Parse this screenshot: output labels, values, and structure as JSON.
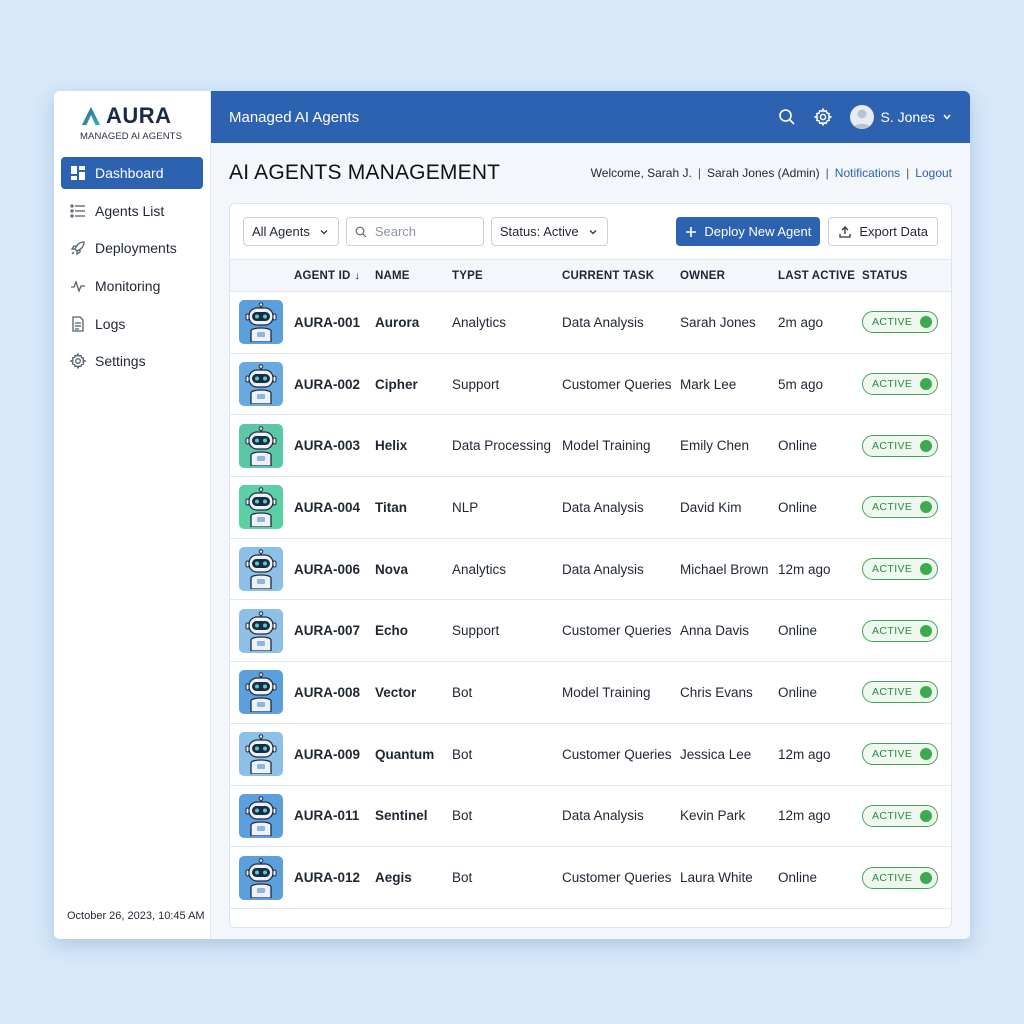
{
  "app": {
    "logo_text": "AURA",
    "logo_subtitle": "MANAGED AI AGENTS",
    "timestamp": "October 26, 2023, 10:45 AM"
  },
  "sidebar": {
    "items": [
      {
        "label": "Dashboard",
        "icon": "dashboard-icon",
        "active": true
      },
      {
        "label": "Agents List",
        "icon": "list-icon",
        "active": false
      },
      {
        "label": "Deployments",
        "icon": "rocket-icon",
        "active": false
      },
      {
        "label": "Monitoring",
        "icon": "pulse-icon",
        "active": false
      },
      {
        "label": "Logs",
        "icon": "document-icon",
        "active": false
      },
      {
        "label": "Settings",
        "icon": "gear-icon",
        "active": false
      }
    ]
  },
  "topbar": {
    "title": "Managed AI Agents",
    "user_name": "S. Jones"
  },
  "header": {
    "page_title": "AI AGENTS MANAGEMENT",
    "welcome": "Welcome, Sarah J.",
    "sep": "|",
    "role": "Sarah Jones (Admin)",
    "notifications": "Notifications",
    "logout": "Logout"
  },
  "toolbar": {
    "filter_label": "All Agents",
    "search_placeholder": "Search",
    "status_filter": "Status: Active",
    "deploy_label": "Deploy New Agent",
    "export_label": "Export Data"
  },
  "table": {
    "columns": [
      "AGENT ID",
      "NAME",
      "TYPE",
      "CURRENT TASK",
      "OWNER",
      "LAST ACTIVE",
      "STATUS"
    ],
    "sort_indicator": "↓",
    "rows": [
      {
        "id": "AURA-001",
        "name": "Aurora",
        "type": "Analytics",
        "task": "Data Analysis",
        "owner": "Sarah Jones",
        "last_active": "2m ago",
        "status": "ACTIVE",
        "avatar_bg": "#5b9fdc"
      },
      {
        "id": "AURA-002",
        "name": "Cipher",
        "type": "Support",
        "task": "Customer Queries",
        "owner": "Mark Lee",
        "last_active": "5m ago",
        "status": "ACTIVE",
        "avatar_bg": "#6aa9e0"
      },
      {
        "id": "AURA-003",
        "name": "Helix",
        "type": "Data Processing",
        "task": "Model Training",
        "owner": "Emily Chen",
        "last_active": "Online",
        "status": "ACTIVE",
        "avatar_bg": "#5cc7a7"
      },
      {
        "id": "AURA-004",
        "name": "Titan",
        "type": "NLP",
        "task": "Data Analysis",
        "owner": "David Kim",
        "last_active": "Online",
        "status": "ACTIVE",
        "avatar_bg": "#5ccfa4"
      },
      {
        "id": "AURA-006",
        "name": "Nova",
        "type": "Analytics",
        "task": "Data Analysis",
        "owner": "Michael Brown",
        "last_active": "12m ago",
        "status": "ACTIVE",
        "avatar_bg": "#8cc0e6"
      },
      {
        "id": "AURA-007",
        "name": "Echo",
        "type": "Support",
        "task": "Customer Queries",
        "owner": "Anna Davis",
        "last_active": "Online",
        "status": "ACTIVE",
        "avatar_bg": "#8cc0e6"
      },
      {
        "id": "AURA-008",
        "name": "Vector",
        "type": "Bot",
        "task": "Model Training",
        "owner": "Chris Evans",
        "last_active": "Online",
        "status": "ACTIVE",
        "avatar_bg": "#5b9fdc"
      },
      {
        "id": "AURA-009",
        "name": "Quantum",
        "type": "Bot",
        "task": "Customer Queries",
        "owner": "Jessica Lee",
        "last_active": "12m ago",
        "status": "ACTIVE",
        "avatar_bg": "#8cc0e6"
      },
      {
        "id": "AURA-011",
        "name": "Sentinel",
        "type": "Bot",
        "task": "Data Analysis",
        "owner": "Kevin Park",
        "last_active": "12m ago",
        "status": "ACTIVE",
        "avatar_bg": "#5b9fdc"
      },
      {
        "id": "AURA-012",
        "name": "Aegis",
        "type": "Bot",
        "task": "Customer Queries",
        "owner": "Laura White",
        "last_active": "Online",
        "status": "ACTIVE",
        "avatar_bg": "#5b9fdc"
      }
    ]
  },
  "colors": {
    "primary": "#2d62b0",
    "status_active": "#3cab50",
    "page_bg": "#d6e8f9"
  }
}
